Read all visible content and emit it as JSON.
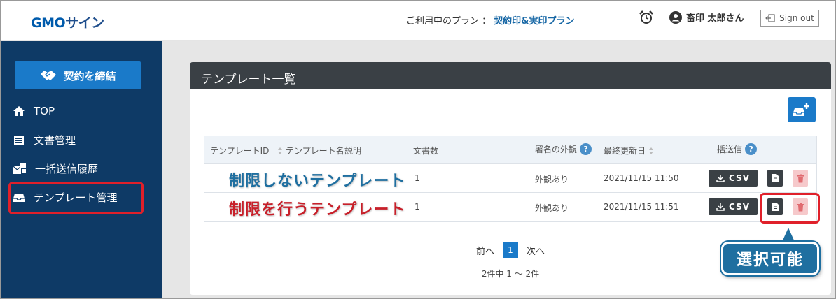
{
  "header": {
    "logo_gmo": "GMO",
    "logo_sign": "サイン",
    "plan_label": "ご利用中のプラン ：",
    "plan_name": "契約印&実印プラン",
    "user_name": "畜印 太郎さん",
    "signout_label": "Sign out"
  },
  "sidebar": {
    "contract_button": "契約を締結",
    "items": [
      {
        "label": "TOP",
        "icon": "home-icon"
      },
      {
        "label": "文書管理",
        "icon": "document-list-icon"
      },
      {
        "label": "一括送信履歴",
        "icon": "bulk-send-icon"
      },
      {
        "label": "テンプレート管理",
        "icon": "inbox-icon"
      }
    ]
  },
  "panel": {
    "title": "テンプレート一覧",
    "columns": {
      "template_id": "テンプレートID",
      "template_name": "テンプレート名",
      "description": "説明",
      "doc_count": "文書数",
      "signature_look": "署名の外観",
      "last_updated": "最終更新日",
      "bulk_send": "一括送信"
    },
    "rows": [
      {
        "name": "制限しないテンプレート",
        "doc_count": "1",
        "look": "外観あり",
        "updated": "2021/11/15 11:50",
        "csv": "CSV"
      },
      {
        "name": "制限を行うテンプレート",
        "doc_count": "1",
        "look": "外観あり",
        "updated": "2021/11/15 11:51",
        "csv": "CSV"
      }
    ],
    "pager": {
      "prev": "前へ",
      "current": "1",
      "next": "次へ"
    },
    "count": "2件中 1 〜 2件"
  },
  "annotation": {
    "callout": "選択可能"
  },
  "colors": {
    "sidebar_bg": "#0e3a66",
    "accent_blue": "#1a7ac9",
    "highlight_red": "#e0202a"
  }
}
